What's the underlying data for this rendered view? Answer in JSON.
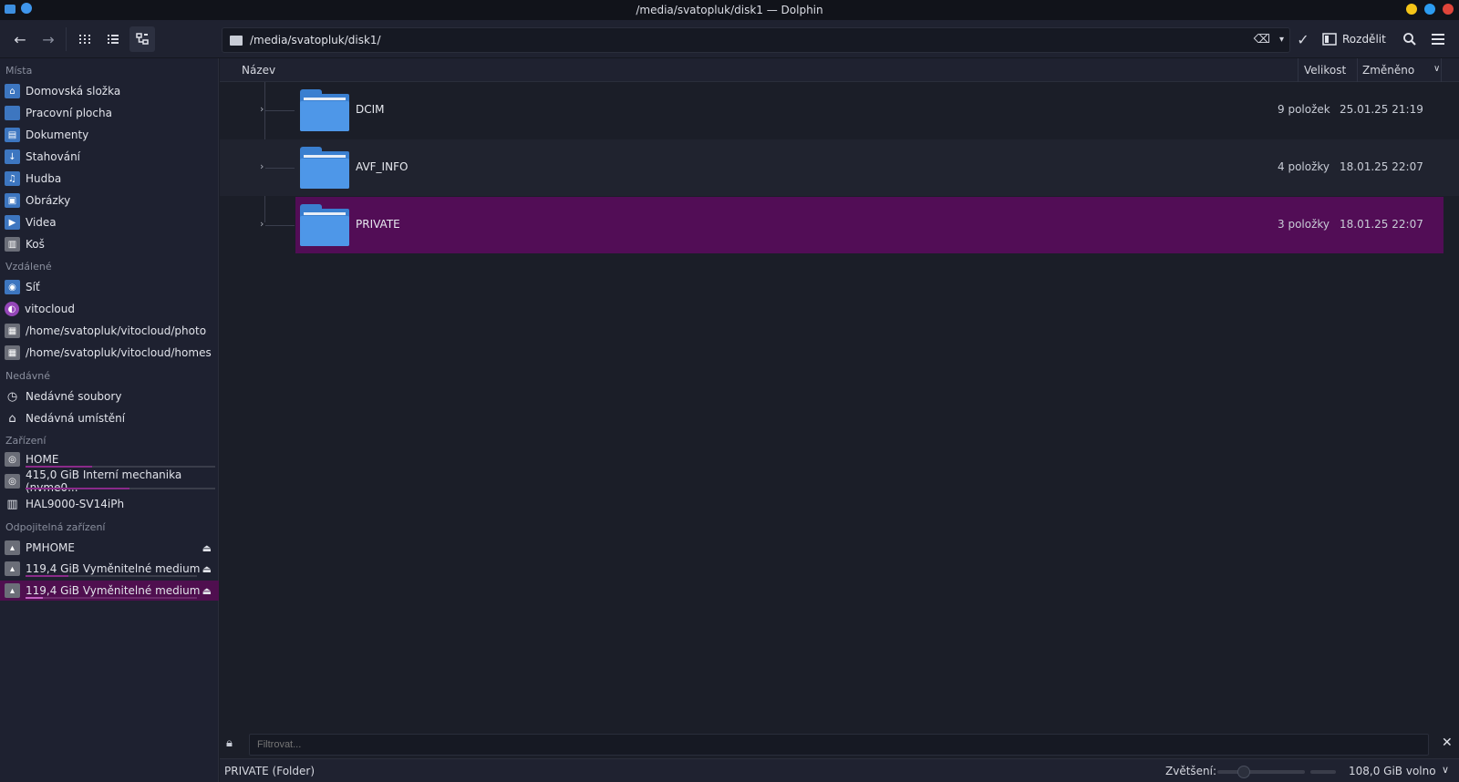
{
  "window": {
    "title": "/media/svatopluk/disk1 — Dolphin",
    "buttons": {
      "minimize_color": "#f5c518",
      "maximize_color": "#2c9cf0",
      "close_color": "#e0453a"
    }
  },
  "toolbar": {
    "back_icon": "←",
    "forward_icon": "→",
    "path": "/media/svatopluk/disk1/",
    "split_label": "Rozdělit"
  },
  "sidebar": {
    "places_header": "Místa",
    "places": [
      {
        "label": "Domovská složka",
        "icon": "home-folder-icon"
      },
      {
        "label": "Pracovní plocha",
        "icon": "desktop-folder-icon"
      },
      {
        "label": "Dokumenty",
        "icon": "documents-folder-icon"
      },
      {
        "label": "Stahování",
        "icon": "downloads-folder-icon"
      },
      {
        "label": "Hudba",
        "icon": "music-folder-icon"
      },
      {
        "label": "Obrázky",
        "icon": "pictures-folder-icon"
      },
      {
        "label": "Videa",
        "icon": "videos-folder-icon"
      },
      {
        "label": "Koš",
        "icon": "trash-icon"
      }
    ],
    "remote_header": "Vzdálené",
    "remote": [
      {
        "label": "Síť",
        "icon": "network-icon"
      },
      {
        "label": "vitocloud",
        "icon": "cloud-icon"
      },
      {
        "label": "/home/svatopluk/vitocloud/photo",
        "icon": "network-drive-icon"
      },
      {
        "label": "/home/svatopluk/vitocloud/homes",
        "icon": "network-drive-icon"
      }
    ],
    "recent_header": "Nedávné",
    "recent": [
      {
        "label": "Nedávné soubory",
        "icon": "clock-icon"
      },
      {
        "label": "Nedávná umístění",
        "icon": "recent-locations-icon"
      }
    ],
    "devices_header": "Zařízení",
    "devices": [
      {
        "label": "HOME",
        "icon": "drive-icon",
        "usage": 0.35
      },
      {
        "label": "415,0 GiB Interní mechanika (nvme0...",
        "icon": "drive-icon",
        "usage": 0.55
      },
      {
        "label": "HAL9000-SV14iPh",
        "icon": "phone-icon"
      }
    ],
    "removable_header": "Odpojitelná zařízení",
    "removable": [
      {
        "label": "PMHOME",
        "icon": "removable-drive-icon"
      },
      {
        "label": "119,4 GiB Vyměnitelné medium",
        "icon": "removable-drive-icon",
        "usage": 0.25
      },
      {
        "label": "119,4 GiB Vyměnitelné medium",
        "icon": "removable-drive-icon",
        "usage": 0.1
      }
    ]
  },
  "columns": {
    "name": "Název",
    "size": "Velikost",
    "modified": "Změněno"
  },
  "files": [
    {
      "name": "DCIM",
      "size": "9 položek",
      "modified": "25.01.25 21:19"
    },
    {
      "name": "AVF_INFO",
      "size": "4 položky",
      "modified": "18.01.25 22:07"
    },
    {
      "name": "PRIVATE",
      "size": "3 položky",
      "modified": "18.01.25 22:07"
    }
  ],
  "filter": {
    "placeholder": "Filtrovat..."
  },
  "status": {
    "selection": "PRIVATE (Folder)",
    "zoom_label": "Zvětšení:",
    "zoom_level": 0.3,
    "free_space": "108,0 GiB volno"
  }
}
